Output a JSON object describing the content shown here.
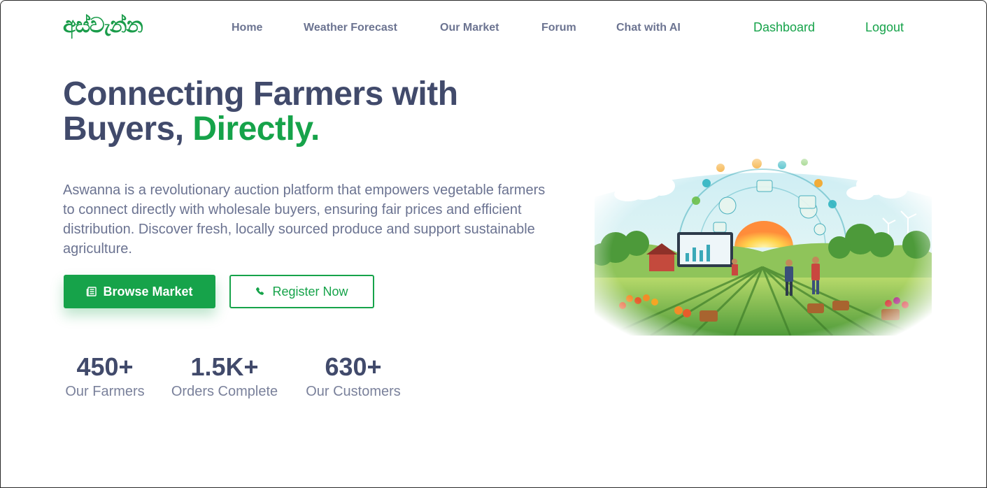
{
  "brand": {
    "logo_text": "අස්වැන්න",
    "accent_color": "#16a34a",
    "text_color": "#414a6b"
  },
  "nav": {
    "links": [
      "Home",
      "Weather Forecast",
      "Our Market",
      "Forum",
      "Chat with AI"
    ],
    "dashboard": "Dashboard",
    "logout": "Logout"
  },
  "hero": {
    "title_line1": "Connecting Farmers with",
    "title_line2_part1": "Buyers, ",
    "title_line2_accent": "Directly.",
    "description": "Aswanna is a revolutionary auction platform that empowers vegetable farmers to connect directly with wholesale buyers, ensuring fair prices and efficient distribution. Discover fresh, locally sourced produce and support sustainable agriculture.",
    "browse_button": "Browse Market",
    "browse_icon": "newspaper-icon",
    "register_button": "Register Now",
    "register_icon": "phone-icon"
  },
  "stats": [
    {
      "value": "450+",
      "label": "Our Farmers"
    },
    {
      "value": "1.5K+",
      "label": "Orders Complete"
    },
    {
      "value": "630+",
      "label": "Our Customers"
    }
  ]
}
